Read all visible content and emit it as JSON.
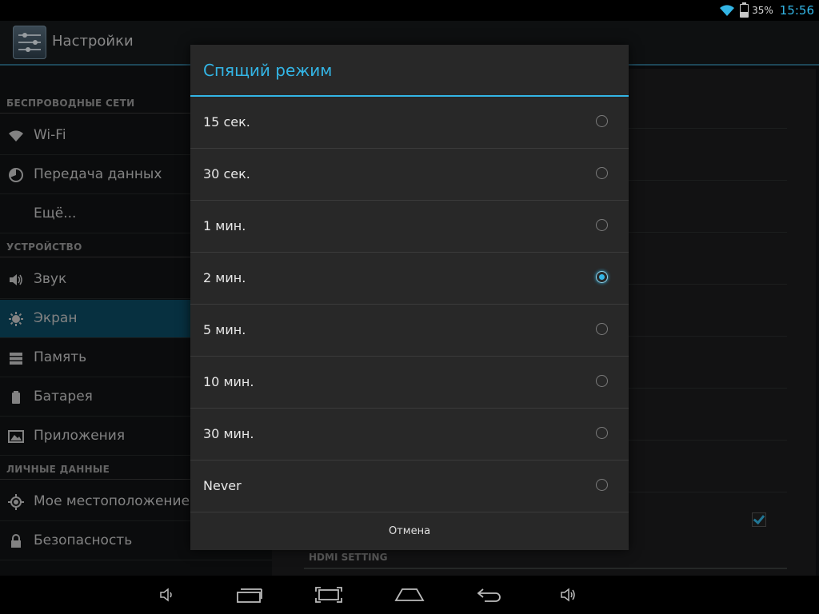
{
  "status": {
    "battery_percent": "35%",
    "battery_level": 0.35,
    "time": "15:56"
  },
  "app": {
    "title": "Настройки"
  },
  "sidebar": {
    "sections": [
      {
        "header": "БЕСПРОВОДНЫЕ СЕТИ",
        "items": [
          {
            "label": "Wi-Fi",
            "icon": "wifi-icon"
          },
          {
            "label": "Передача данных",
            "icon": "data-usage-icon"
          },
          {
            "label": "Ещё...",
            "icon": ""
          }
        ]
      },
      {
        "header": "УСТРОЙСТВО",
        "items": [
          {
            "label": "Звук",
            "icon": "sound-icon"
          },
          {
            "label": "Экран",
            "icon": "display-icon",
            "active": true
          },
          {
            "label": "Память",
            "icon": "storage-icon"
          },
          {
            "label": "Батарея",
            "icon": "battery-icon"
          },
          {
            "label": "Приложения",
            "icon": "apps-icon"
          }
        ]
      },
      {
        "header": "ЛИЧНЫЕ ДАННЫЕ",
        "items": [
          {
            "label": "Мое местоположение",
            "icon": "location-icon"
          },
          {
            "label": "Безопасность",
            "icon": "lock-icon"
          }
        ]
      }
    ]
  },
  "detail": {
    "section_header": "HDMI SETTING"
  },
  "dialog": {
    "title": "Спящий режим",
    "options": [
      {
        "label": "15 сек.",
        "checked": false
      },
      {
        "label": "30 сек.",
        "checked": false
      },
      {
        "label": "1 мин.",
        "checked": false
      },
      {
        "label": "2 мин.",
        "checked": true
      },
      {
        "label": "5 мин.",
        "checked": false
      },
      {
        "label": "10 мин.",
        "checked": false
      },
      {
        "label": "30 мин.",
        "checked": false
      },
      {
        "label": "Never",
        "checked": false
      }
    ],
    "cancel_label": "Отмена"
  },
  "navbar": {
    "buttons": [
      "volume-down-icon",
      "recent-apps-icon",
      "screenshot-icon",
      "home-icon",
      "back-icon",
      "volume-up-icon"
    ]
  },
  "colors": {
    "accent": "#33b5e5",
    "active_item": "#0c4a63"
  }
}
